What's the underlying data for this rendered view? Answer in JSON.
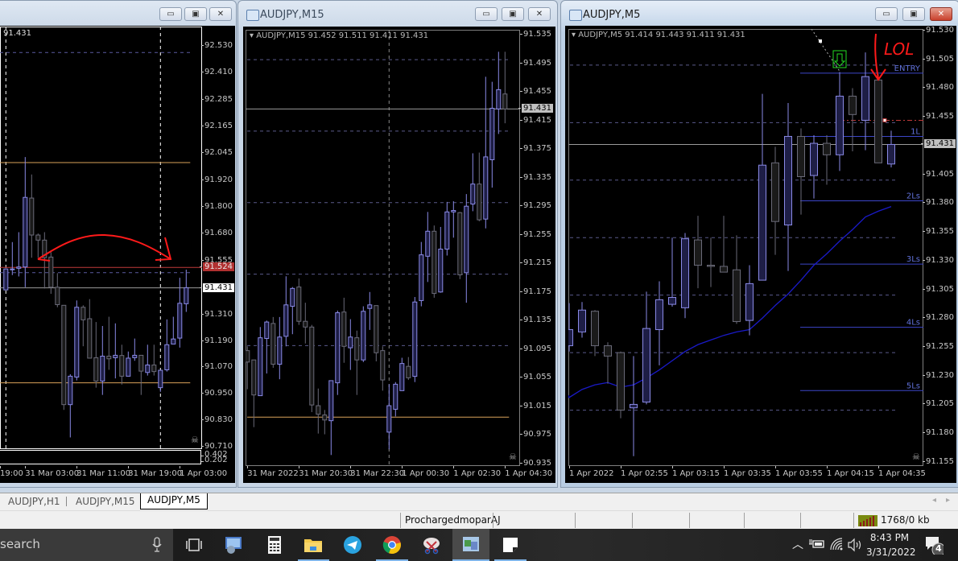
{
  "windows": [
    {
      "title": "",
      "header": "91.431"
    },
    {
      "title": "AUDJPY,M15",
      "header": "AUDJPY,M15  91.452 91.511 91.411 91.431"
    },
    {
      "title": "AUDJPY,M5",
      "header": "AUDJPY,M5  91.414 91.443 91.411 91.431"
    }
  ],
  "window_buttons": {
    "minimize": "▭",
    "maximize": "▣",
    "close": "✕"
  },
  "colors": {
    "bull_border": "#8a8ae6",
    "bull_fill": "#1e1e46",
    "bear_border": "#6a6a78",
    "bear_fill": "#1a1a1a",
    "ma_line": "#1a1ac8",
    "level_line": "#3c46c8",
    "orange_line": "#d9a25a",
    "red_line": "#c03a3a",
    "price_line": "#9a9a9a",
    "drawing_red": "#ff1a1a",
    "arrow_green": "#22dd22"
  },
  "chart_data": [
    {
      "type": "candlestick",
      "symbol": "AUDJPY",
      "timeframe": "H1",
      "ylim": [
        90.71,
        92.53
      ],
      "y_labels": [
        "92.530",
        "92.410",
        "92.285",
        "92.165",
        "92.045",
        "91.920",
        "91.800",
        "91.680",
        "91.555",
        "91.310",
        "91.190",
        "91.070",
        "90.950",
        "90.830",
        "90.710"
      ],
      "current_price": "91.431",
      "marked_price": "91.524",
      "indicator_labels": [
        "0.402",
        "0.202"
      ],
      "x_ticks": [
        {
          "bar": -4,
          "label": "19:00"
        },
        {
          "bar": 3,
          "label": "31 Mar 03:00"
        },
        {
          "bar": 11,
          "label": "31 Mar 11:00"
        },
        {
          "bar": 19,
          "label": "31 Mar 19:00"
        },
        {
          "bar": 27,
          "label": "1 Apr 03:00"
        }
      ],
      "hlines": [
        {
          "price": 92.0,
          "kind": "orange"
        },
        {
          "price": 91.0,
          "kind": "orange"
        },
        {
          "price": 91.524,
          "kind": "red"
        },
        {
          "price": 91.431,
          "kind": "price"
        },
        {
          "price": 92.5,
          "kind": "dashed"
        },
        {
          "price": 91.5,
          "kind": "dashed"
        }
      ],
      "vlines": [
        0,
        24
      ],
      "candles": [
        [
          91.422,
          91.52,
          91.422,
          91.517
        ],
        [
          91.517,
          91.639,
          91.489,
          91.517
        ],
        [
          91.52,
          91.684,
          91.483,
          91.526
        ],
        [
          91.526,
          92.025,
          91.434,
          91.842
        ],
        [
          91.839,
          91.946,
          91.568,
          91.671
        ],
        [
          91.671,
          91.678,
          91.568,
          91.648
        ],
        [
          91.648,
          91.684,
          91.428,
          91.568
        ],
        [
          91.571,
          91.593,
          91.404,
          91.434
        ],
        [
          91.434,
          91.498,
          91.343,
          91.355
        ],
        [
          91.352,
          91.352,
          90.877,
          90.901
        ],
        [
          90.901,
          91.039,
          90.752,
          91.03
        ],
        [
          91.026,
          91.374,
          91.011,
          91.343
        ],
        [
          91.343,
          91.352,
          91.166,
          91.286
        ],
        [
          91.291,
          91.38,
          91.112,
          91.112
        ],
        [
          91.114,
          91.276,
          90.978,
          91.008
        ],
        [
          91.008,
          91.258,
          90.945,
          91.121
        ],
        [
          91.121,
          91.3,
          91.059,
          91.109
        ],
        [
          91.114,
          91.27,
          91.02,
          91.125
        ],
        [
          91.124,
          91.173,
          90.992,
          91.03
        ],
        [
          91.03,
          91.142,
          91.03,
          91.112
        ],
        [
          91.114,
          91.201,
          91.1,
          91.125
        ],
        [
          91.125,
          91.125,
          90.945,
          91.053
        ],
        [
          91.047,
          91.173,
          91.033,
          91.081
        ],
        [
          91.081,
          91.173,
          91.033,
          91.051
        ],
        [
          90.978,
          91.057,
          90.959,
          91.057
        ],
        [
          91.059,
          91.288,
          91.051,
          91.173
        ],
        [
          91.176,
          91.3,
          91.176,
          91.199
        ],
        [
          91.203,
          91.477,
          91.16,
          91.361
        ],
        [
          91.359,
          91.514,
          91.322,
          91.432
        ]
      ]
    },
    {
      "type": "candlestick",
      "symbol": "AUDJPY",
      "timeframe": "M15",
      "ylim": [
        90.935,
        91.535
      ],
      "y_labels": [
        "91.535",
        "91.495",
        "91.455",
        "91.415",
        "91.375",
        "91.335",
        "91.295",
        "91.255",
        "91.215",
        "91.175",
        "91.135",
        "91.095",
        "91.055",
        "91.015",
        "90.975",
        "90.935"
      ],
      "current_price": "91.431",
      "x_ticks": [
        {
          "bar": 0,
          "label": "31 Mar 2022"
        },
        {
          "bar": 8,
          "label": "31 Mar 20:30"
        },
        {
          "bar": 16,
          "label": "31 Mar 22:30"
        },
        {
          "bar": 24,
          "label": "1 Apr 00:30"
        },
        {
          "bar": 32,
          "label": "1 Apr 02:30"
        },
        {
          "bar": 40,
          "label": "1 Apr 04:30"
        }
      ],
      "grid": [
        91.5,
        91.4,
        91.3,
        91.2,
        91.1
      ],
      "hlines": [
        {
          "price": 91.0,
          "kind": "orange"
        },
        {
          "price": 91.431,
          "kind": "price"
        }
      ],
      "vlines": [
        22
      ],
      "candles": [
        [
          91.093,
          91.099,
          91.039,
          91.077
        ],
        [
          91.08,
          91.08,
          90.986,
          91.031
        ],
        [
          91.03,
          91.126,
          91.03,
          91.111
        ],
        [
          91.11,
          91.135,
          91.061,
          91.133
        ],
        [
          91.131,
          91.14,
          91.069,
          91.074
        ],
        [
          91.074,
          91.14,
          91.053,
          91.112
        ],
        [
          91.113,
          91.197,
          91.099,
          91.157
        ],
        [
          91.155,
          91.182,
          91.116,
          91.18
        ],
        [
          91.182,
          91.194,
          91.129,
          91.134
        ],
        [
          91.134,
          91.16,
          91.103,
          91.126
        ],
        [
          91.126,
          91.129,
          91.007,
          91.017
        ],
        [
          91.016,
          91.04,
          90.977,
          91.004
        ],
        [
          91.003,
          91.01,
          90.976,
          90.996
        ],
        [
          90.995,
          91.051,
          90.947,
          91.051
        ],
        [
          91.048,
          91.149,
          91.031,
          91.146
        ],
        [
          91.147,
          91.167,
          91.076,
          91.099
        ],
        [
          91.097,
          91.137,
          91.066,
          91.112
        ],
        [
          91.111,
          91.121,
          91.031,
          91.08
        ],
        [
          91.08,
          91.155,
          91.077,
          91.148
        ],
        [
          91.152,
          91.175,
          91.122,
          91.157
        ],
        [
          91.156,
          91.156,
          91.078,
          91.09
        ],
        [
          91.093,
          91.099,
          91.037,
          91.052
        ],
        [
          90.979,
          91.046,
          90.955,
          91.016
        ],
        [
          91.011,
          91.049,
          91.001,
          91.046
        ],
        [
          91.037,
          91.083,
          91.037,
          91.075
        ],
        [
          91.071,
          91.084,
          91.052,
          91.055
        ],
        [
          91.057,
          91.168,
          91.049,
          91.161
        ],
        [
          91.163,
          91.245,
          91.155,
          91.227
        ],
        [
          91.225,
          91.287,
          91.189,
          91.26
        ],
        [
          91.26,
          91.268,
          91.167,
          91.173
        ],
        [
          91.175,
          91.266,
          91.174,
          91.235
        ],
        [
          91.235,
          91.301,
          91.226,
          91.287
        ],
        [
          91.287,
          91.302,
          91.251,
          91.289
        ],
        [
          91.286,
          91.287,
          91.193,
          91.199
        ],
        [
          91.202,
          91.312,
          91.16,
          91.295
        ],
        [
          91.298,
          91.369,
          91.288,
          91.326
        ],
        [
          91.326,
          91.37,
          91.274,
          91.276
        ],
        [
          91.277,
          91.476,
          91.264,
          91.364
        ],
        [
          91.36,
          91.469,
          91.321,
          91.432
        ],
        [
          91.431,
          91.511,
          91.396,
          91.458
        ],
        [
          91.452,
          91.511,
          91.411,
          91.431
        ]
      ]
    },
    {
      "type": "candlestick",
      "symbol": "AUDJPY",
      "timeframe": "M5",
      "ylim": [
        91.155,
        91.53
      ],
      "y_labels": [
        "91.530",
        "91.505",
        "91.480",
        "91.455",
        "91.405",
        "91.380",
        "91.355",
        "91.330",
        "91.305",
        "91.280",
        "91.255",
        "91.230",
        "91.205",
        "91.180",
        "91.155"
      ],
      "current_price": "91.431",
      "x_ticks": [
        {
          "bar": 0,
          "label": "1 Apr 2022"
        },
        {
          "bar": 4,
          "label": "1 Apr 02:55"
        },
        {
          "bar": 8,
          "label": "1 Apr 03:15"
        },
        {
          "bar": 12,
          "label": "1 Apr 03:35"
        },
        {
          "bar": 16,
          "label": "1 Apr 03:55"
        },
        {
          "bar": 20,
          "label": "1 Apr 04:15"
        },
        {
          "bar": 24,
          "label": "1 Apr 04:35"
        }
      ],
      "grid": [
        91.5,
        91.45,
        91.4,
        91.35,
        91.3,
        91.25,
        91.2
      ],
      "hlines": [
        {
          "price": 91.431,
          "kind": "price"
        }
      ],
      "levels": [
        {
          "label": "ENTRY",
          "price": 91.493
        },
        {
          "label": "1L",
          "price": 91.438
        },
        {
          "label": "2Ls",
          "price": 91.382
        },
        {
          "label": "3Ls",
          "price": 91.327
        },
        {
          "label": "4Ls",
          "price": 91.272
        },
        {
          "label": "5Ls",
          "price": 91.217
        }
      ],
      "red_dashed_price": 91.452,
      "annotation_text": "LOL",
      "ma": [
        91.211,
        91.218,
        91.222,
        91.224,
        91.22,
        91.222,
        91.228,
        91.235,
        91.243,
        91.251,
        91.257,
        91.261,
        91.265,
        91.268,
        91.27,
        91.28,
        91.291,
        91.301,
        91.313,
        91.326,
        91.336,
        91.347,
        91.357,
        91.368,
        91.373,
        91.377
      ],
      "candles": [
        [
          91.256,
          91.293,
          91.251,
          91.27
        ],
        [
          91.268,
          91.294,
          91.263,
          91.287
        ],
        [
          91.286,
          91.287,
          91.247,
          91.256
        ],
        [
          91.256,
          91.259,
          91.223,
          91.247
        ],
        [
          91.25,
          91.251,
          91.193,
          91.2
        ],
        [
          91.202,
          91.247,
          91.16,
          91.205
        ],
        [
          91.207,
          91.303,
          91.205,
          91.271
        ],
        [
          91.27,
          91.312,
          91.239,
          91.296
        ],
        [
          91.292,
          91.35,
          91.29,
          91.298
        ],
        [
          91.289,
          91.354,
          91.28,
          91.349
        ],
        [
          91.348,
          91.369,
          91.306,
          91.326
        ],
        [
          91.326,
          91.35,
          91.307,
          91.325
        ],
        [
          91.325,
          91.369,
          91.32,
          91.32
        ],
        [
          91.322,
          91.352,
          91.275,
          91.277
        ],
        [
          91.278,
          91.326,
          91.265,
          91.31
        ],
        [
          91.313,
          91.475,
          91.313,
          91.413
        ],
        [
          91.415,
          91.429,
          91.335,
          91.364
        ],
        [
          91.361,
          91.467,
          91.321,
          91.438
        ],
        [
          91.438,
          91.445,
          91.37,
          91.403
        ],
        [
          91.404,
          91.439,
          91.384,
          91.432
        ],
        [
          91.432,
          91.439,
          91.396,
          91.422
        ],
        [
          91.422,
          91.494,
          91.408,
          91.473
        ],
        [
          91.473,
          91.48,
          91.425,
          91.457
        ],
        [
          91.452,
          91.511,
          91.426,
          91.49
        ],
        [
          91.487,
          91.492,
          91.415,
          91.415
        ],
        [
          91.414,
          91.443,
          91.411,
          91.431
        ]
      ]
    }
  ],
  "tabs": [
    {
      "label": "AUDJPY,H1"
    },
    {
      "label": "AUDJPY,M15"
    },
    {
      "label": "AUDJPY,M5",
      "active": true
    }
  ],
  "status": {
    "profile": "ProchargedmoparAJ",
    "traffic": "1768/0 kb"
  },
  "taskbar": {
    "search_placeholder": "search",
    "apps": [
      "task-view",
      "network-computer",
      "calculator",
      "file-explorer",
      "telegram",
      "chrome",
      "snipping-tool",
      "metatrader",
      "sticky-notes"
    ],
    "time": "8:43 PM",
    "date": "3/31/2022",
    "notifications": "4"
  }
}
